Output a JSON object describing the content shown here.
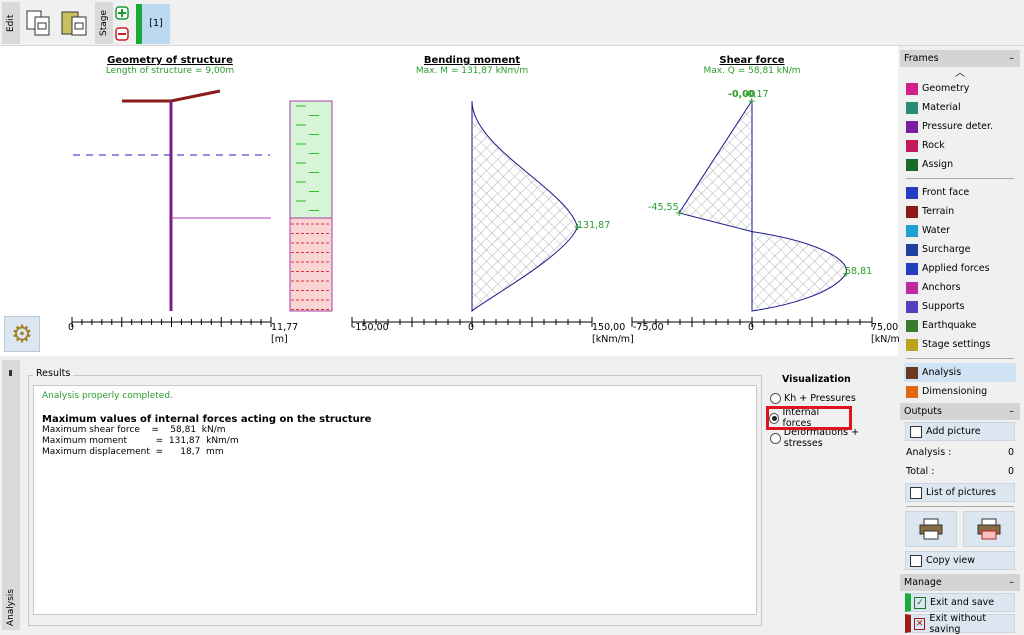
{
  "toolbar": {
    "edit_tab": "Edit",
    "stage_tab": "Stage",
    "stage_button": "[1]",
    "icons": [
      "copy-icon",
      "paste-icon",
      "add-stage-icon",
      "remove-stage-icon"
    ]
  },
  "geometry": {
    "title": "Geometry of structure",
    "subtitle": "Length of structure = 9,00m",
    "axis_min": "0",
    "axis_max": "11,77",
    "unit": "[m]"
  },
  "moment": {
    "title": "Bending moment",
    "subtitle": "Max. M = 131,87 kNm/m",
    "axis_min": "-150,00",
    "axis_zero": "0",
    "axis_max": "150,00",
    "unit": "[kNm/m]",
    "peak_label": "131,87"
  },
  "shear": {
    "title": "Shear force",
    "subtitle": "Max. Q = 58,81 kN/m",
    "axis_min": "-75,00",
    "axis_zero": "0",
    "axis_max": "75,00",
    "unit": "[kN/m]",
    "top_label": "-0,17",
    "top_label_overlap": "-0,00",
    "min_label": "-45,55",
    "max_label": "58,81"
  },
  "chart_data": [
    {
      "type": "area",
      "title": "Bending moment",
      "xlim": [
        -150,
        150
      ],
      "unit": "kNm/m",
      "points": [
        {
          "depth": 0,
          "value": 0
        },
        {
          "depth": 5.4,
          "value": 131.87
        },
        {
          "depth": 9,
          "value": 0
        }
      ]
    },
    {
      "type": "area",
      "title": "Shear force",
      "xlim": [
        -75,
        75
      ],
      "unit": "kN/m",
      "points": [
        {
          "depth": 0,
          "value": -0.17
        },
        {
          "depth": 4.8,
          "value": -45.55
        },
        {
          "depth": 5.6,
          "value": 0
        },
        {
          "depth": 7.4,
          "value": 58.81
        },
        {
          "depth": 9,
          "value": 0
        }
      ]
    }
  ],
  "results": {
    "side_tab": "Analysis",
    "group_label": "Results",
    "status": "Analysis properly completed.",
    "heading": "Maximum values of internal forces acting on the structure",
    "lines": [
      "Maximum shear force    =    58,81  kN/m",
      "Maximum moment          =  131,87  kNm/m",
      "Maximum displacement  =      18,7  mm"
    ]
  },
  "visualization": {
    "label": "Visualization",
    "options": [
      {
        "label": "Kh + Pressures",
        "selected": false
      },
      {
        "label": "Internal forces",
        "selected": true
      },
      {
        "label": "Deformations + stresses",
        "selected": false
      }
    ],
    "highlight_color": "#e0141e"
  },
  "sidebar": {
    "frames_label": "Frames",
    "minimize": "–",
    "frames": [
      "Geometry",
      "Material",
      "Pressure deter.",
      "Rock",
      "Assign"
    ],
    "stage_frames": [
      "Front face",
      "Terrain",
      "Water",
      "Surcharge",
      "Applied forces",
      "Anchors",
      "Supports",
      "Earthquake",
      "Stage settings"
    ],
    "analysis_frames": [
      "Analysis",
      "Dimensioning"
    ],
    "outputs_label": "Outputs",
    "add_picture": "Add picture",
    "analysis_count_label": "Analysis :",
    "analysis_count": "0",
    "total_label": "Total :",
    "total_count": "0",
    "list_pictures": "List of pictures",
    "copy_view": "Copy view",
    "manage_label": "Manage",
    "exit_save": "Exit and save",
    "exit_nosave": "Exit without saving"
  },
  "colors": {
    "accent_green": "#2a9d2a",
    "wall": "#7a1f8a",
    "soil_top": "#d6f5d6",
    "soil_bottom": "#f9d4d4",
    "curve": "#1a1a8a",
    "selected_item": "#cfe3f5"
  }
}
